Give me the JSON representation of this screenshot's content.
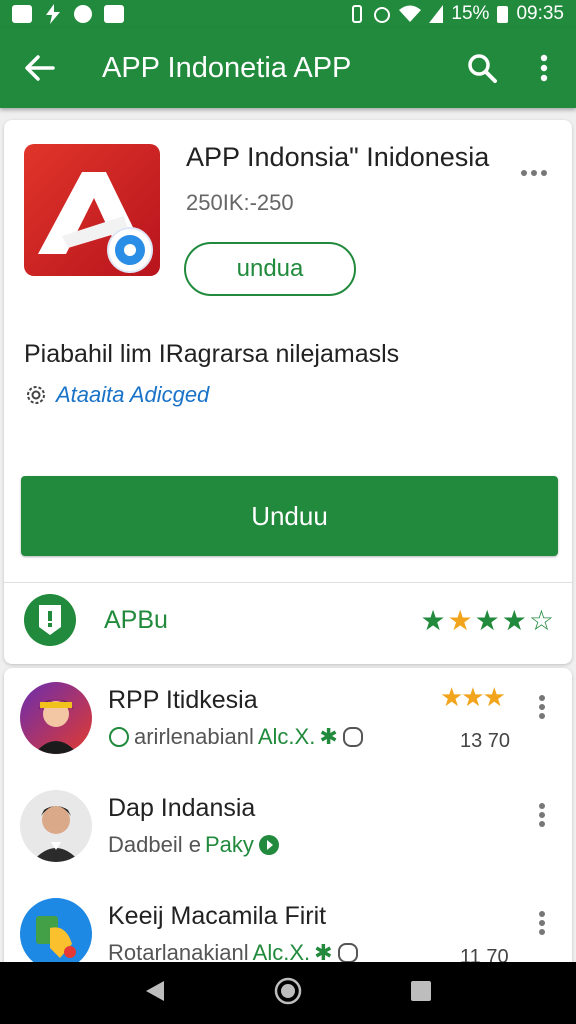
{
  "status_bar": {
    "battery_percent": "15%",
    "time": "09:35",
    "left_icons": [
      "gallery-icon",
      "bolt-icon",
      "record-icon",
      "photo-icon"
    ],
    "right_icons": [
      "vibrate-icon",
      "alarm-icon",
      "wifi-icon",
      "signal-icon",
      "battery-icon"
    ]
  },
  "app_bar": {
    "title": "APP Indonetia APP"
  },
  "app": {
    "title": "APP Indonsia\" Inidonesia",
    "size": "250IK:-250",
    "small_button_label": "undua",
    "description": "Piabahil lim IRagrarsa nilejamasls",
    "developer": "Ataaita Adicged",
    "install_button_label": "Unduu",
    "badge_label": "APBu",
    "rating_stars": 4.5
  },
  "list": [
    {
      "title": "RPP Itidkesia",
      "subtitle_gray": "arirlenabianl",
      "subtitle_green": "Alc.X.",
      "count": "13 70",
      "stars": 3
    },
    {
      "title": "Dap Indansia",
      "subtitle_gray": "Dadbeil e",
      "subtitle_green": "Paky",
      "count": "",
      "stars": 0
    },
    {
      "title": "Keeij Macamila Firit",
      "subtitle_gray": "Rotarlanakianl",
      "subtitle_green": "Alc.X.",
      "count": "11 70",
      "stars": 0
    }
  ],
  "colors": {
    "primary": "#218a3c",
    "star": "#f2a41c",
    "link": "#1a73c8"
  }
}
